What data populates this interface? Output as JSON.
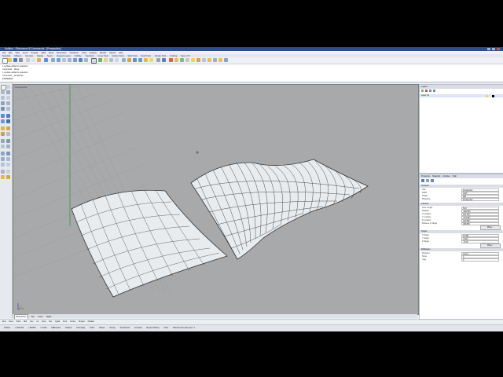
{
  "window": {
    "title": "Untitled - Rhinoceros 5 Commercial - [Perspective]"
  },
  "menu": [
    "File",
    "Edit",
    "View",
    "Curve",
    "Surface",
    "Solid",
    "Mesh",
    "Dimension",
    "Transform",
    "Tools",
    "Analyze",
    "Render",
    "Panels",
    "Help"
  ],
  "toolbar_tabs": [
    "Standard",
    "CPlanes",
    "Set View",
    "Display",
    "Select",
    "Viewport Layout",
    "Visibility",
    "Transform",
    "Curve Tools",
    "Surface Tools",
    "Solid Tools",
    "Mesh Tools",
    "Render Tools",
    "Drafting",
    "New in V5"
  ],
  "command_history": [
    "1 surface added to selection.",
    "Command: _Move",
    "1 surface added to selection.",
    "Command: _Properties",
    "Command:"
  ],
  "viewport": {
    "title": "Perspective"
  },
  "viewport_tabs": [
    "Perspective",
    "Top",
    "Front",
    "Right"
  ],
  "osnaps": [
    "End",
    "Near",
    "Point",
    "Mid",
    "Cen",
    "Int",
    "Perp",
    "Tan",
    "Quad",
    "Knot",
    "Vertex",
    "Project",
    "Disable"
  ],
  "status": [
    "CPlane",
    "x 182.063",
    "y 89.860",
    "z 0.000",
    "Millimeters",
    "Default",
    "Grid Snap",
    "Ortho",
    "Planar",
    "Osnap",
    "SmartTrack",
    "Gumball",
    "Record History",
    "Filter",
    "Minutes from last save: 2"
  ],
  "layers_panel": {
    "title": "Layers",
    "column_name": "Layer 01"
  },
  "properties_panel": {
    "tabs": [
      "Properties",
      "Materials",
      "Libraries",
      "Help"
    ],
    "view_section": "Viewport",
    "view_rows": [
      [
        "Title",
        "Perspective"
      ],
      [
        "Width",
        "1023"
      ],
      [
        "Height",
        "548"
      ],
      [
        "Projection",
        "Perspective"
      ]
    ],
    "camera_section": "Camera",
    "camera_rows": [
      [
        "Lens Length",
        "50.0"
      ],
      [
        "Rotation",
        "-180.000"
      ],
      [
        "X Location",
        "143.753"
      ],
      [
        "Y Location",
        "-179.907"
      ],
      [
        "Z Location",
        "142.586"
      ],
      [
        "Distance to Target",
        "268.859"
      ]
    ],
    "camera_location_btn": "Place...",
    "target_section": "Target",
    "target_rows": [
      [
        "X Target",
        "42.394"
      ],
      [
        "Y Target",
        "-6.511"
      ],
      [
        "Z Target",
        "-76.92"
      ]
    ],
    "target_location_btn": "Place...",
    "wallpaper_section": "Wallpaper",
    "wallpaper_rows": [
      [
        "Filename",
        "(none)"
      ],
      [
        "Show",
        "0"
      ],
      [
        "Gray",
        "0"
      ]
    ]
  },
  "colors": {
    "viewport_bg": "#a8a9ab",
    "surface": "#e9ecef",
    "isocurve": "#222222"
  }
}
